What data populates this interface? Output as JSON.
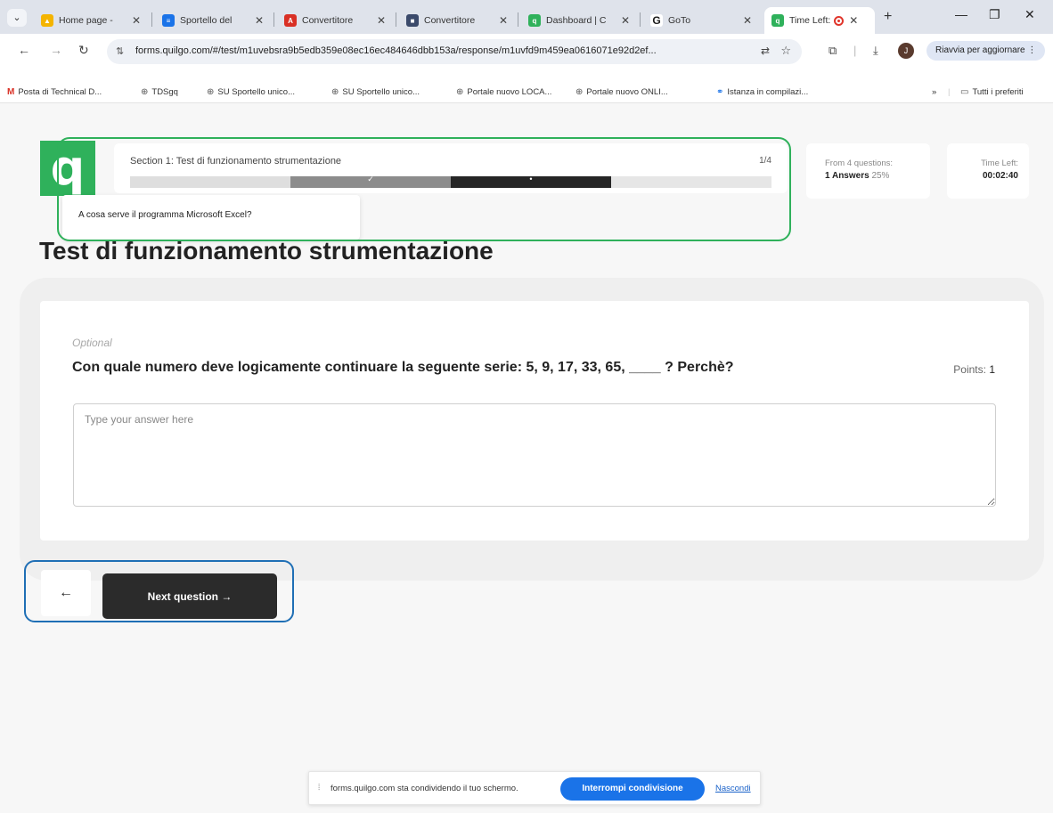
{
  "browser": {
    "tabs": [
      {
        "label": "Home page -",
        "favicon": "drive-icon",
        "color": "#f4b400"
      },
      {
        "label": "Sportello del",
        "favicon": "doc-icon",
        "color": "#1a73e8"
      },
      {
        "label": "Convertitore",
        "favicon": "acrobat-icon",
        "color": "#d93025"
      },
      {
        "label": "Convertitore",
        "favicon": "app-icon",
        "color": "#3b4a6b"
      },
      {
        "label": "Dashboard | C",
        "favicon": "quilgo-icon",
        "color": "#2fb15b"
      },
      {
        "label": "GoTo",
        "favicon": "goto-icon",
        "color": "#333333"
      },
      {
        "label": "Time Left:",
        "favicon": "quilgo-icon",
        "color": "#2fb15b",
        "active": true
      }
    ],
    "url": "forms.quilgo.com/#/test/m1uvebsra9b5edb359e08ec16ec484646dbb153a/response/m1uvfd9m459ea0616071e92d2ef...",
    "update_button": "Riavvia per aggiornare",
    "profile_initial": "J",
    "bookmarks": [
      {
        "label": "Posta di Technical D...",
        "icon": "gmail-icon"
      },
      {
        "label": "TDSgq",
        "icon": "globe-icon"
      },
      {
        "label": "SU Sportello unico...",
        "icon": "globe-icon"
      },
      {
        "label": "SU Sportello unico...",
        "icon": "globe-icon"
      },
      {
        "label": "Portale nuovo LOCA...",
        "icon": "globe-icon"
      },
      {
        "label": "Portale nuovo ONLI...",
        "icon": "globe-icon"
      },
      {
        "label": "Istanza in compilazi...",
        "icon": "link-icon"
      }
    ],
    "bookmarks_overflow": "»",
    "all_bookmarks": "Tutti i preferiti"
  },
  "quiz": {
    "logo_letter": "q",
    "section_label": "Section 1: Test di funzionamento strumentazione",
    "section_count": "1/4",
    "progress_segments": [
      {
        "state": "empty",
        "glyph": ""
      },
      {
        "state": "answered",
        "glyph": "✓"
      },
      {
        "state": "current",
        "glyph": "•"
      },
      {
        "state": "empty",
        "glyph": ""
      }
    ],
    "tooltip": "A cosa serve il programma Microsoft Excel?",
    "stats": {
      "questions_label": "From 4 questions:",
      "answers_value": "1 Answers",
      "answers_pct": "25%",
      "time_label": "Time Left:",
      "time_value": "00:02:40"
    },
    "title": "Test di funzionamento strumentazione",
    "question": {
      "optional_label": "Optional",
      "text": "Con quale numero deve logicamente continuare la seguente serie: 5, 9, 17, 33, 65, ____ ? Perchè?",
      "points_label": "Points:",
      "points_value": "1",
      "answer_placeholder": "Type your answer here",
      "answer_value": ""
    },
    "nav": {
      "back_label": "←",
      "next_label": "Next question →"
    }
  },
  "share_bar": {
    "text": "forms.quilgo.com sta condividendo il tuo schermo.",
    "stop_label": "Interrompi condivisione",
    "hide_label": "Nascondi"
  },
  "colors": {
    "accent_green": "#2fb15b",
    "nav_outline_blue": "#1f6fb5",
    "share_blue": "#1a73e8"
  }
}
